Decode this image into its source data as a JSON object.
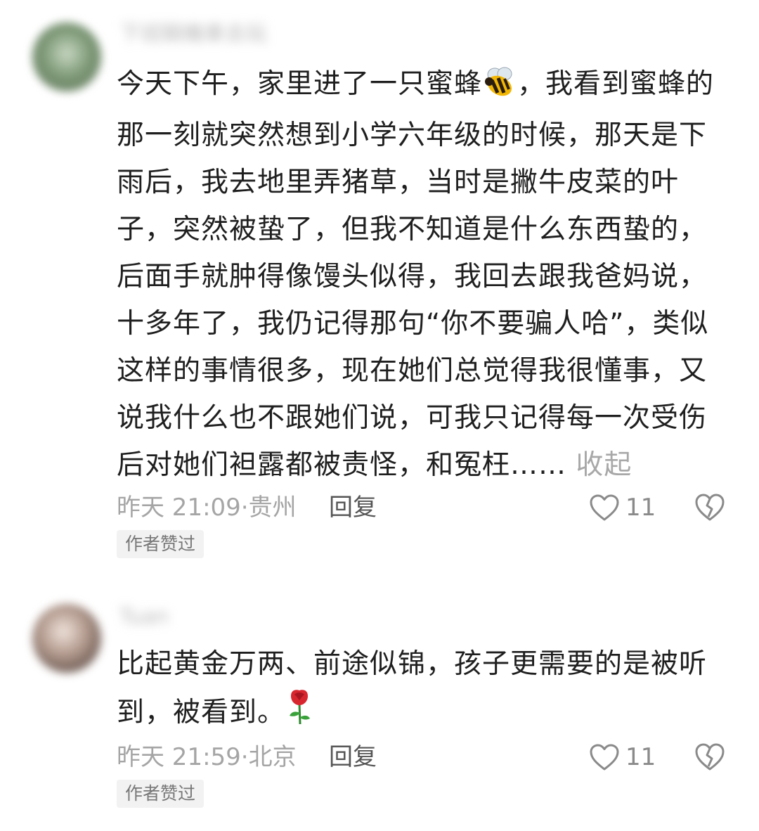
{
  "comments": [
    {
      "username": "下班騎機車去玩",
      "text_before_emoji": "今天下午，家里进了一只蜜蜂",
      "emoji": "bee-icon",
      "text_after_emoji": "，我看到蜜蜂的那一刻就突然想到小学六年级的时候，那天是下雨后，我去地里弄猪草，当时是撇牛皮菜的叶子，突然被蛰了，但我不知道是什么东西蛰的，后面手就肿得像馒头似得，我回去跟我爸妈说，十多年了，我仍记得那句“你不要骗人哈”，类似这样的事情很多，现在她们总觉得我很懂事，又说我什么也不跟她们说，可我只记得每一次受伤后对她们袒露都被责怪，和冤枉……",
      "collapse_label": "收起",
      "time": "昨天 21:09·贵州",
      "reply_label": "回复",
      "like_count": "11",
      "badge": "作者赞过"
    },
    {
      "username": "Tuan",
      "text_before_emoji": "比起黄金万两、前途似锦，孩子更需要的是被听到，被看到。",
      "emoji": "rose-icon",
      "text_after_emoji": "",
      "time": "昨天 21:59·北京",
      "reply_label": "回复",
      "like_count": "11",
      "badge": "作者赞过"
    }
  ]
}
